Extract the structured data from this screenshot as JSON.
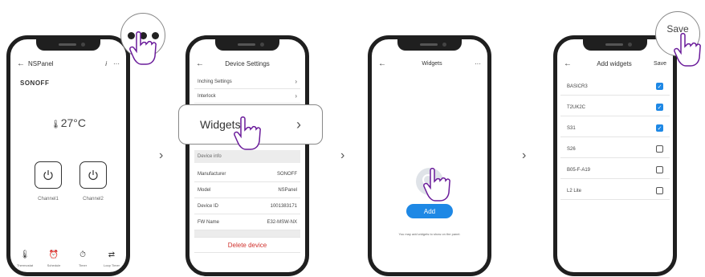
{
  "phone1": {
    "title": "NSPanel",
    "brand": "SONOFF",
    "temperature": "27°C",
    "channels": [
      "Channel1",
      "Channel2"
    ],
    "bottom_nav": [
      "Thermostat",
      "Schedule",
      "Timer",
      "Loop Timer"
    ]
  },
  "phone2": {
    "title": "Device Settings",
    "rows": [
      "Inching Settings",
      "Interlock"
    ],
    "callout": "Widgets",
    "info_header": "Device info",
    "info_rows": [
      {
        "label": "Manufacturer",
        "value": "SONOFF"
      },
      {
        "label": "Model",
        "value": "NSPanel"
      },
      {
        "label": "Device ID",
        "value": "1001383171"
      },
      {
        "label": "FW Name",
        "value": "E32-MSW-NX"
      }
    ],
    "delete": "Delete device"
  },
  "phone3": {
    "title": "Widgets",
    "add": "Add",
    "hint": "You may add widgets to show on the panel."
  },
  "phone4": {
    "title": "Add widgets",
    "save": "Save",
    "bubble_save": "Save",
    "widgets": [
      {
        "name": "BASICR3",
        "checked": true
      },
      {
        "name": "T2UK2C",
        "checked": true
      },
      {
        "name": "S31",
        "checked": true
      },
      {
        "name": "S26",
        "checked": false
      },
      {
        "name": "B05-F-A19",
        "checked": false
      },
      {
        "name": "L2 Lite",
        "checked": false
      }
    ]
  },
  "separator": "›",
  "colors": {
    "accent": "#1e88e5",
    "danger": "#d0312d"
  }
}
